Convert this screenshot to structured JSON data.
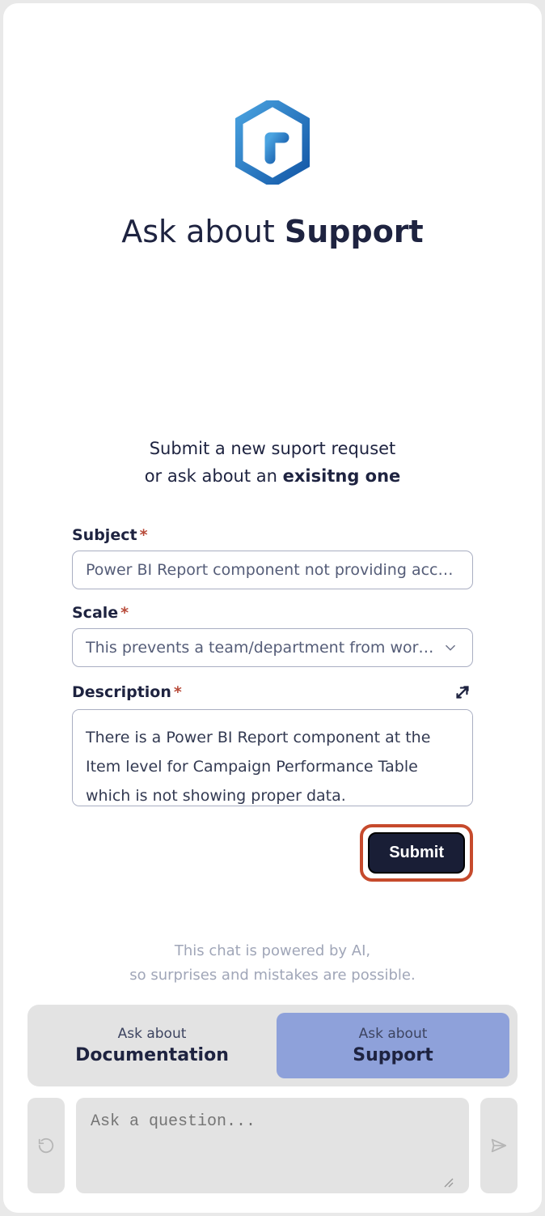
{
  "header": {
    "title_prefix": "Ask about ",
    "title_bold": "Support"
  },
  "subtitle": {
    "line1": "Submit a new suport requset",
    "line2_prefix": "or ask about an ",
    "line2_bold": "exisitng one"
  },
  "form": {
    "subject_label": "Subject",
    "subject_value": "Power BI Report component not providing accu…",
    "scale_label": "Scale",
    "scale_value": "This prevents a team/department from wor…",
    "description_label": "Description",
    "description_value": "There is a Power BI Report component at the Item level for Campaign Performance Table which is not showing proper data.",
    "submit_label": "Submit",
    "required_mark": "*"
  },
  "disclaimer": {
    "line1": "This chat is powered by AI,",
    "line2": "so surprises and mistakes are possible."
  },
  "tabs": {
    "items": [
      {
        "small": "Ask about",
        "big": "Documentation",
        "active": false
      },
      {
        "small": "Ask about",
        "big": "Support",
        "active": true
      }
    ]
  },
  "composer": {
    "placeholder": "Ask a question..."
  }
}
